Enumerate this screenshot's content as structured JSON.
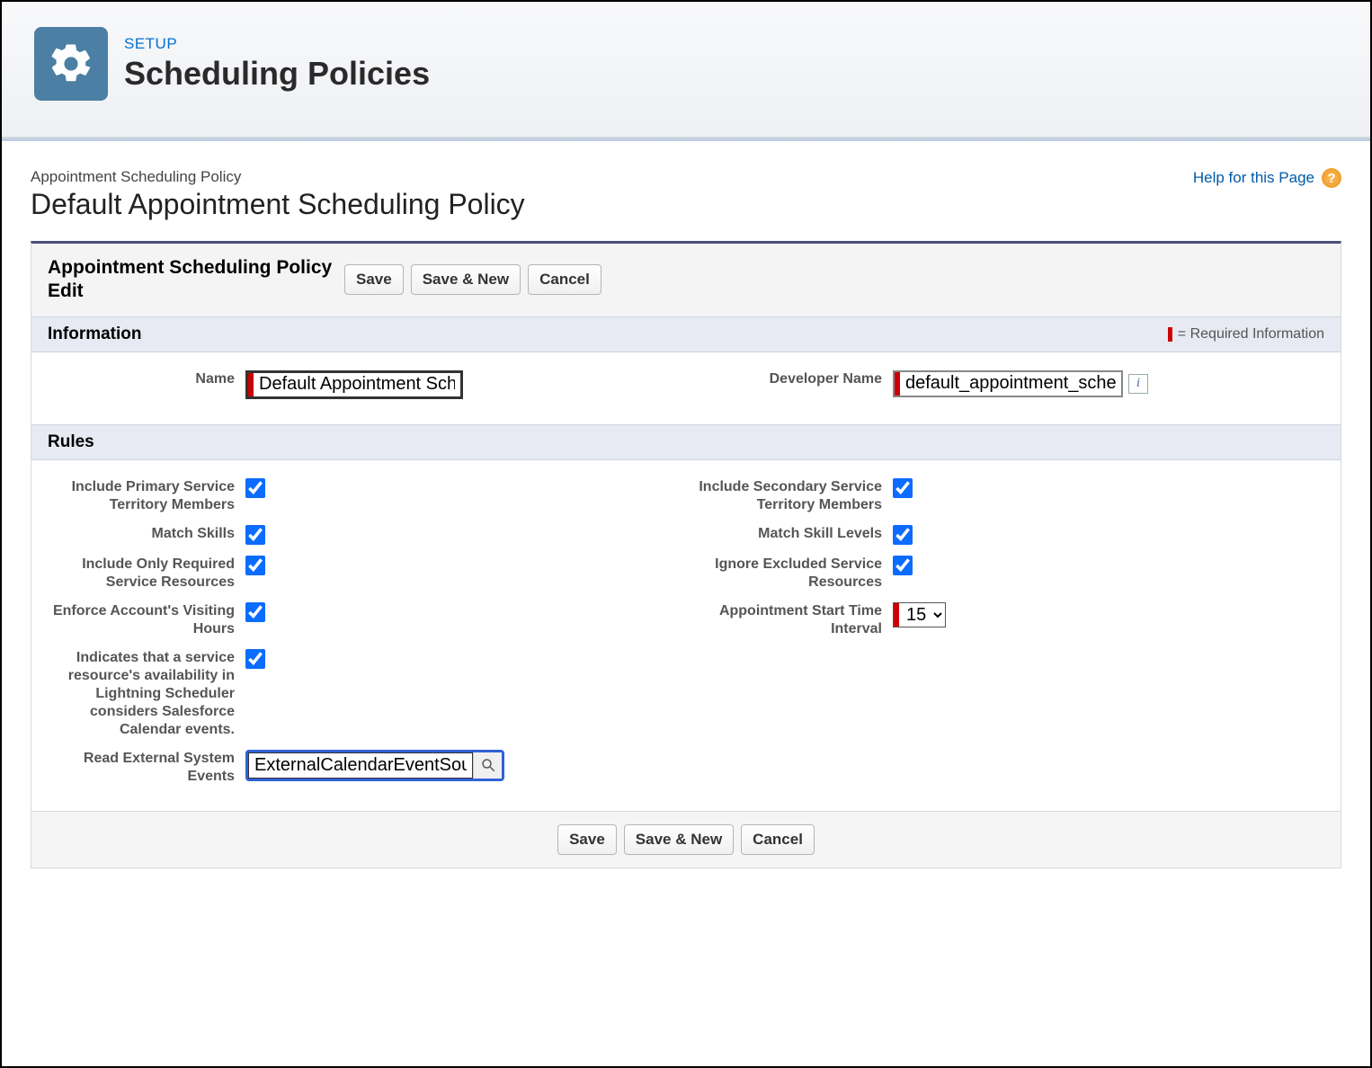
{
  "header": {
    "eyebrow": "SETUP",
    "title": "Scheduling Policies"
  },
  "obj": {
    "type": "Appointment Scheduling Policy",
    "title": "Default Appointment Scheduling Policy",
    "help": "Help for this Page"
  },
  "editHeader": "Appointment Scheduling Policy Edit",
  "buttons": {
    "save": "Save",
    "saveNew": "Save & New",
    "cancel": "Cancel"
  },
  "sections": {
    "information": "Information",
    "rules": "Rules",
    "reqLegend": "= Required Information"
  },
  "fields": {
    "name": {
      "label": "Name",
      "value": "Default Appointment Scheduling Policy"
    },
    "devName": {
      "label": "Developer Name",
      "value": "default_appointment_scheduling_policy"
    },
    "primaryMembers": {
      "label": "Include Primary Service Territory Members",
      "checked": true
    },
    "secondaryMembers": {
      "label": "Include Secondary Service Territory Members",
      "checked": true
    },
    "matchSkills": {
      "label": "Match Skills",
      "checked": true
    },
    "matchSkillLevels": {
      "label": "Match Skill Levels",
      "checked": true
    },
    "onlyRequired": {
      "label": "Include Only Required Service Resources",
      "checked": true
    },
    "ignoreExcluded": {
      "label": "Ignore Excluded Service Resources",
      "checked": true
    },
    "enforceVisiting": {
      "label": "Enforce Account's Visiting Hours",
      "checked": true
    },
    "startInterval": {
      "label": "Appointment Start Time Interval",
      "value": "15",
      "options": [
        "15"
      ]
    },
    "considerCalendar": {
      "label": "Indicates that a service resource's availability in Lightning Scheduler considers Salesforce Calendar events.",
      "checked": true
    },
    "externalEvents": {
      "label": "Read External System Events",
      "value": "ExternalCalendarEventSource"
    }
  }
}
